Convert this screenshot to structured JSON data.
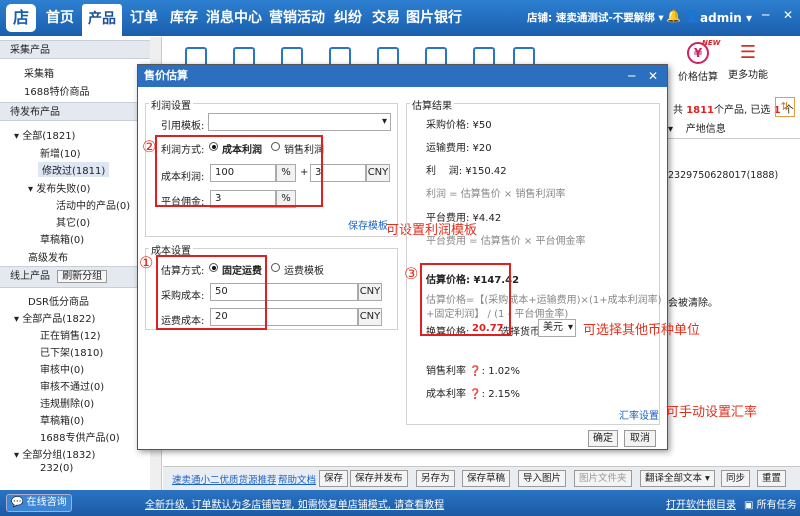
{
  "topnav": {
    "tabs": [
      "首页",
      "产品",
      "订单",
      "库存",
      "消息中心",
      "营销活动",
      "纠纷",
      "交易",
      "图片银行"
    ],
    "active_tab": "产品",
    "shop_label": "店铺:",
    "shop_name": "速卖通测试-不要解绑",
    "user": "admin"
  },
  "sidebar": {
    "s1_title": "采集产品",
    "s1_items": [
      "采集箱",
      "1688特价商品"
    ],
    "s2_title": "待发布产品",
    "s2_items": [
      "全部(1821)",
      "新增(10)",
      "修改过(1811)",
      "发布失败(0)",
      "活动中的产品(0)",
      "其它(0)",
      "草稿箱(0)",
      "高级发布"
    ],
    "s3_title": "线上产品",
    "s3_btn": "刷新分组",
    "s3_items": [
      "DSR低分商品",
      "全部产品(1822)",
      "正在销售(12)",
      "已下架(1810)",
      "审核中(0)",
      "审核不通过(0)",
      "违规删除(0)",
      "草稿箱(0)",
      "1688专供产品(0)",
      "全部分组(1832)",
      "232(0)"
    ]
  },
  "background": {
    "new_badge": "NEW",
    "price_estimate": "价格估算",
    "more": "更多功能",
    "count_prefix": "共",
    "count": "1811",
    "count_mid": "个产品, 已选",
    "selected": "1",
    "count_suffix": "个",
    "col_header": "产地信息",
    "row_text": "2329750628017(1888)",
    "notice_text": "会被清除。"
  },
  "modal": {
    "title": "售价估算",
    "profit": {
      "section": "利润设置",
      "template_label": "引用模板:",
      "template_value": "",
      "method_label": "利润方式:",
      "opt_cost": "成本利润",
      "opt_sale": "销售利润",
      "cost_profit_label": "成本利润:",
      "cost_profit_value": "100",
      "pct": "%",
      "plus": "+",
      "extra_value": "3",
      "currency": "CNY",
      "commission_label": "平台佣金:",
      "commission_value": "3",
      "save_template": "保存模板"
    },
    "cost": {
      "section": "成本设置",
      "method_label": "估算方式:",
      "opt_fixed": "固定运费",
      "opt_template": "运费模板",
      "purchase_label": "采购成本:",
      "purchase_value": "50",
      "shipping_label": "运费成本:",
      "shipping_value": "20",
      "currency": "CNY"
    },
    "result": {
      "section": "估算结果",
      "purchase": "采购价格: ¥50",
      "shipping": "运输费用: ¥20",
      "profit": "利    润: ¥150.42",
      "profit_formula": "利润 = 估算售价 × 销售利润率",
      "platform_fee": "平台费用: ¥4.42",
      "fee_formula": "平台费用 = 估算售价 × 平台佣金率",
      "estimate": "估算价格: ¥147.42",
      "estimate_formula_1": "估算价格=【(采购成本+运输费用)×(1+成本利润率)",
      "estimate_formula_2": "+固定利润】 / (1 - 平台佣金率)",
      "convert_label": "换算价格:",
      "convert_value": "20.77",
      "currency_label": "选择货币",
      "currency_value": "美元",
      "sales_margin": "销售利率",
      "sales_margin_value": "1.02%",
      "cost_margin": "成本利率",
      "cost_margin_value": "2.15%",
      "rate_setting": "汇率设置"
    },
    "ok": "确定",
    "cancel": "取消"
  },
  "annotations": {
    "c1": "①",
    "c2": "②",
    "c3": "③",
    "a_template": "可设置利润模板",
    "a_currency": "可选择其他币种单位",
    "a_rate": "可手动设置汇率"
  },
  "bottom": {
    "link1": "速卖通小二优质货源推荐",
    "link2": "帮助文档",
    "buttons": [
      "保存",
      "保存并发布",
      "另存为",
      "保存草稿",
      "导入图片",
      "图片文件夹",
      "翻译全部文本",
      "同步",
      "重置"
    ]
  },
  "status": {
    "consult": "在线咨询",
    "notice": "全新升级, 订单默认为多店铺管理, 如需恢复单店铺模式, 请查看教程",
    "open_dir": "打开软件根目录",
    "tasks": "所有任务"
  }
}
